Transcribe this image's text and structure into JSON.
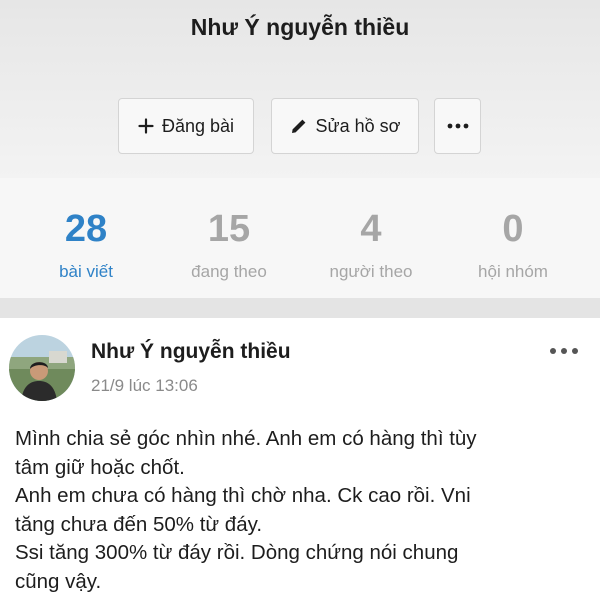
{
  "profile": {
    "name": "Như Ý nguyễn thiều",
    "actions": {
      "post_label": "Đăng bài",
      "edit_label": "Sửa hồ sơ"
    }
  },
  "stats": [
    {
      "value": "28",
      "label": "bài viết",
      "active": true
    },
    {
      "value": "15",
      "label": "đang theo",
      "active": false
    },
    {
      "value": "4",
      "label": "người theo",
      "active": false
    },
    {
      "value": "0",
      "label": "hội nhóm",
      "active": false
    }
  ],
  "post": {
    "author": "Như Ý nguyễn thiều",
    "timestamp": "21/9 lúc 13:06",
    "lines": [
      "Mình chia sẻ góc nhìn nhé. Anh em có hàng thì tùy",
      "tâm giữ hoặc chốt.",
      "Anh em chưa có hàng thì chờ nha. Ck cao rồi. Vni",
      "tăng chưa đến 50% từ đáy.",
      "Ssi tăng 300% từ đáy rồi. Dòng chứng nói chung",
      "cũng vậy."
    ]
  },
  "icons": {
    "post": "plus-icon",
    "edit": "pencil-icon",
    "more": "more-horizontal-icon",
    "post_menu": "more-horizontal-icon"
  },
  "colors": {
    "accent": "#2f82c7",
    "muted": "#a6a6a6"
  }
}
